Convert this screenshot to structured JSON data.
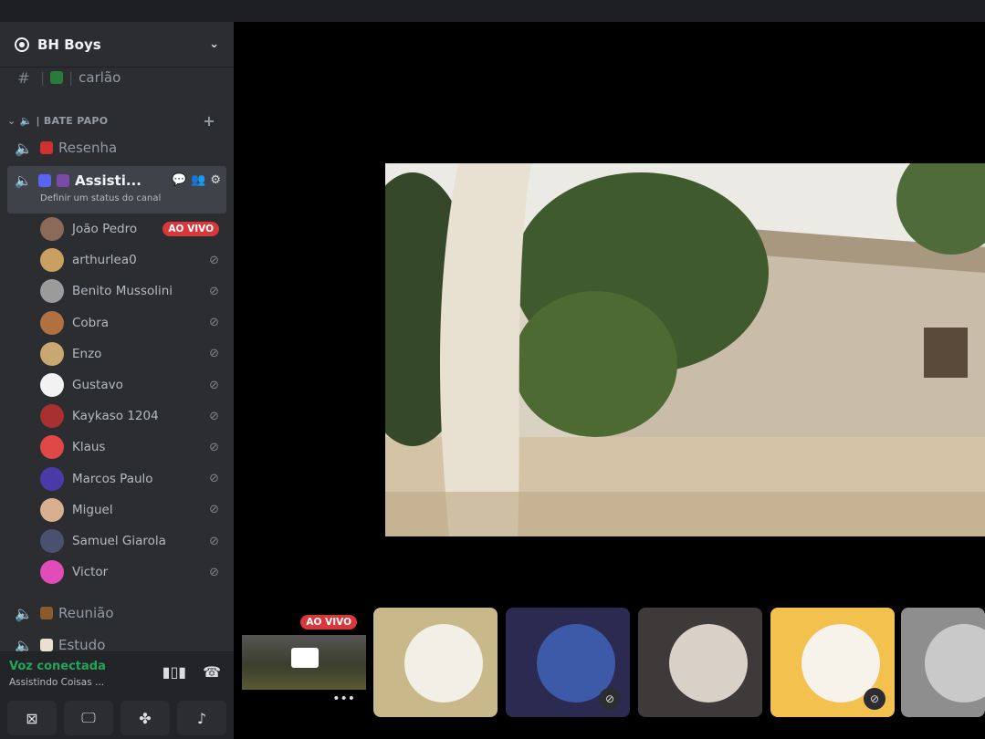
{
  "server": {
    "name": "BH Boys"
  },
  "channels": {
    "text_top": "carlão",
    "category": "BATE PAPO",
    "voice1": "Resenha",
    "active": {
      "name": "Assisti...",
      "status": "Definir um status do canal"
    },
    "voice3": "Reunião",
    "voice4": "Estudo"
  },
  "users": [
    {
      "name": "João Pedro",
      "badge": "AO VIVO",
      "color": "#8a6a58"
    },
    {
      "name": "arthurlea0",
      "color": "#c9a061"
    },
    {
      "name": "Benito Mussolini",
      "color": "#9b9b9b"
    },
    {
      "name": "Cobra",
      "color": "#b07040"
    },
    {
      "name": "Enzo",
      "color": "#c8a870"
    },
    {
      "name": "Gustavo",
      "color": "#f2f2f2"
    },
    {
      "name": "Kaykaso 1204",
      "color": "#a83030"
    },
    {
      "name": "Klaus",
      "color": "#e04848"
    },
    {
      "name": "Marcos Paulo",
      "color": "#4a3aa8"
    },
    {
      "name": "Miguel",
      "color": "#d8b090"
    },
    {
      "name": "Samuel Giarola",
      "color": "#4a5070"
    },
    {
      "name": "Victor",
      "color": "#e04cb8"
    }
  ],
  "voice": {
    "connected": "Voz conectada",
    "channel": "Assistindo Coisas ..."
  },
  "stream": {
    "badge": "AO VIVO"
  },
  "icons": {
    "hash": "#",
    "speaker": "🔈",
    "chevron": "⌄",
    "plus": "+",
    "mute": "⊘",
    "more": "•••",
    "settings": "⚙",
    "chat": "💬",
    "invite": "👥",
    "waveform": "▮▯▮",
    "hangup": "☎",
    "camera_off": "⊠",
    "screen_share": "🖵",
    "activities": "✤",
    "soundboard": "♪"
  }
}
